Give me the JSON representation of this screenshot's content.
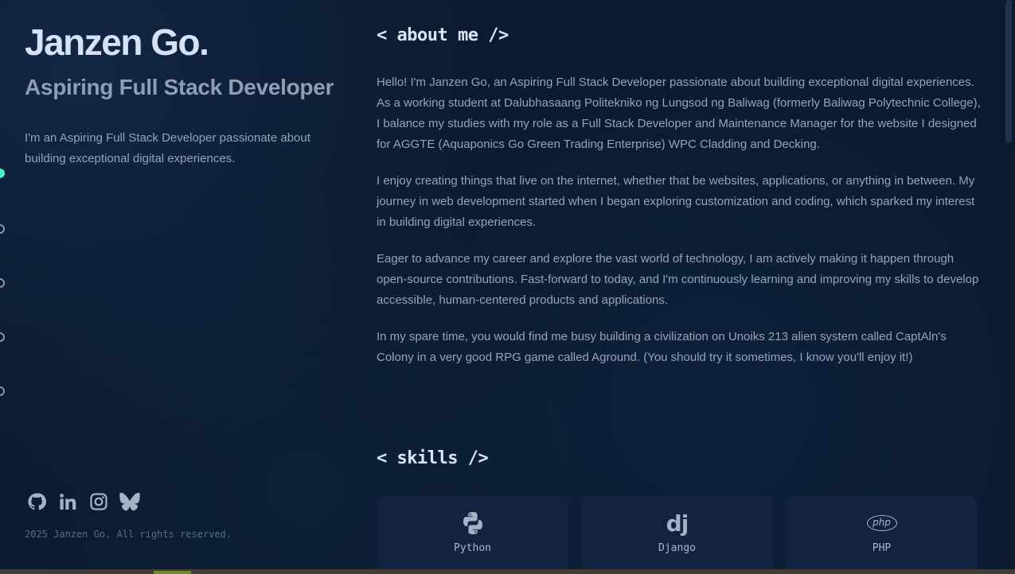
{
  "profile": {
    "name": "Janzen Go.",
    "role": "Aspiring Full Stack Developer",
    "intro": "I'm an Aspiring Full Stack Developer passionate about building exceptional digital experiences."
  },
  "nav": {
    "dots": [
      "section-1",
      "section-2",
      "section-3",
      "section-4",
      "section-5"
    ],
    "active_index": 0
  },
  "socials": [
    {
      "name": "github-icon"
    },
    {
      "name": "linkedin-icon"
    },
    {
      "name": "instagram-icon"
    },
    {
      "name": "bluesky-icon"
    }
  ],
  "footer": {
    "copyright": "2025 Janzen Go. All rights reserved."
  },
  "about": {
    "title": "< about me />",
    "paragraphs": [
      "Hello! I'm Janzen Go, an Aspiring Full Stack Developer passionate about building exceptional digital experiences. As a working student at Dalubhasaang Politekniko ng Lungsod ng Baliwag (formerly Baliwag Polytechnic College), I balance my studies with my role as a Full Stack Developer and Maintenance Manager for the website I designed for AGGTE (Aquaponics Go Green Trading Enterprise) WPC Cladding and Decking.",
      "I enjoy creating things that live on the internet, whether that be websites, applications, or anything in between. My journey in web development started when I began exploring customization and coding, which sparked my interest in building digital experiences.",
      "Eager to advance my career and explore the vast world of technology, I am actively making it happen through open-source contributions. Fast-forward to today, and I'm continuously learning and improving my skills to develop accessible, human-centered products and applications.",
      "In my spare time, you would find me busy building a civilization on Unoiks 213 alien system called CaptAln's Colony in a very good RPG game called Aground. (You should try it sometimes, I know you'll enjoy it!)"
    ]
  },
  "skills": {
    "title": "< skills />",
    "items": [
      {
        "label": "Python",
        "icon": "python-icon"
      },
      {
        "label": "Django",
        "icon": "django-icon",
        "glyph": "dj"
      },
      {
        "label": "PHP",
        "icon": "php-icon",
        "glyph": "php"
      }
    ]
  },
  "colors": {
    "background": "#0b1a30",
    "accent": "#4ff0c8",
    "card": "#13233f",
    "heading": "#dbe4f4"
  }
}
